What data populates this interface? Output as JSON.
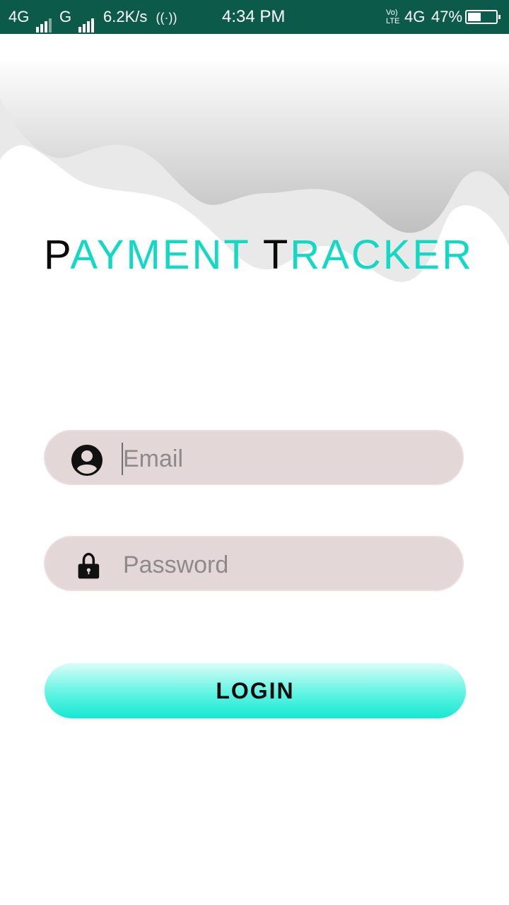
{
  "status_bar": {
    "network1": "4G",
    "network2": "G",
    "speed": "6.2K/s",
    "hotspot_icon": "hotspot-icon",
    "time": "4:34 PM",
    "volte": "Vo) LTE",
    "network3": "4G",
    "battery_percent": "47%",
    "battery_level": 0.47
  },
  "logo": {
    "part1_initial": "P",
    "part1_rest": "AYMENT",
    "part2_initial": "T",
    "part2_rest": "RACKER",
    "colors": {
      "initial": "#0b0b0b",
      "rest": "#12d9c3"
    }
  },
  "form": {
    "email": {
      "placeholder": "Email",
      "value": "",
      "icon": "account-circle-icon"
    },
    "password": {
      "placeholder": "Password",
      "value": "",
      "icon": "lock-icon"
    },
    "login_label": "LOGIN"
  },
  "colors": {
    "status_bar": "#0b5a4a",
    "field_bg": "#e3d8d7",
    "button_accent": "#16e8d2"
  }
}
